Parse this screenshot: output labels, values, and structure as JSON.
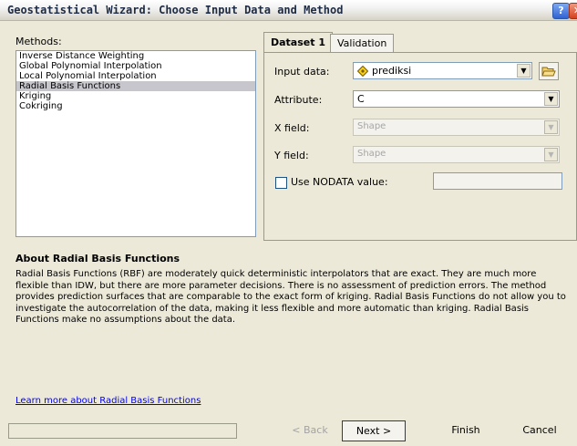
{
  "window": {
    "title": "Geostatistical Wizard: Choose Input Data and Method",
    "help_glyph": "?",
    "close_glyph": "✕"
  },
  "methods": {
    "label": "Methods:",
    "items": [
      "Inverse Distance Weighting",
      "Global Polynomial Interpolation",
      "Local Polynomial Interpolation",
      "Radial Basis Functions",
      "Kriging",
      "Cokriging"
    ],
    "selected": "Radial Basis Functions"
  },
  "tabs": [
    {
      "label": "Dataset 1",
      "active": true
    },
    {
      "label": "Validation",
      "active": false
    }
  ],
  "dataset": {
    "input_label": "Input data:",
    "input_value": "prediksi",
    "attribute_label": "Attribute:",
    "attribute_value": "C",
    "x_label": "X field:",
    "x_value": "Shape",
    "y_label": "Y field:",
    "y_value": "Shape",
    "nodata_label": "Use NODATA value:",
    "nodata_checked": false,
    "nodata_value": ""
  },
  "about": {
    "title": "About Radial Basis Functions",
    "text": "Radial Basis Functions (RBF) are moderately quick deterministic interpolators that are exact. They are much more flexible than IDW, but there are more parameter decisions. There is no assessment of prediction errors. The method provides prediction surfaces that are comparable to the exact form of kriging. Radial Basis Functions do not allow you to investigate the autocorrelation of the data, making it less flexible and more automatic than kriging. Radial Basis Functions make no assumptions about the data.",
    "link": "Learn more about Radial Basis Functions"
  },
  "buttons": {
    "back": "< Back",
    "next": "Next >",
    "finish": "Finish",
    "cancel": "Cancel"
  },
  "icons": {
    "dataset": "layer-diamond-icon",
    "open": "open-folder-icon",
    "dropdown": "chevron-down-icon"
  },
  "colors": {
    "selection": "#c6c6cc",
    "link": "#0000ee",
    "dialog_bg": "#ece9d8"
  }
}
